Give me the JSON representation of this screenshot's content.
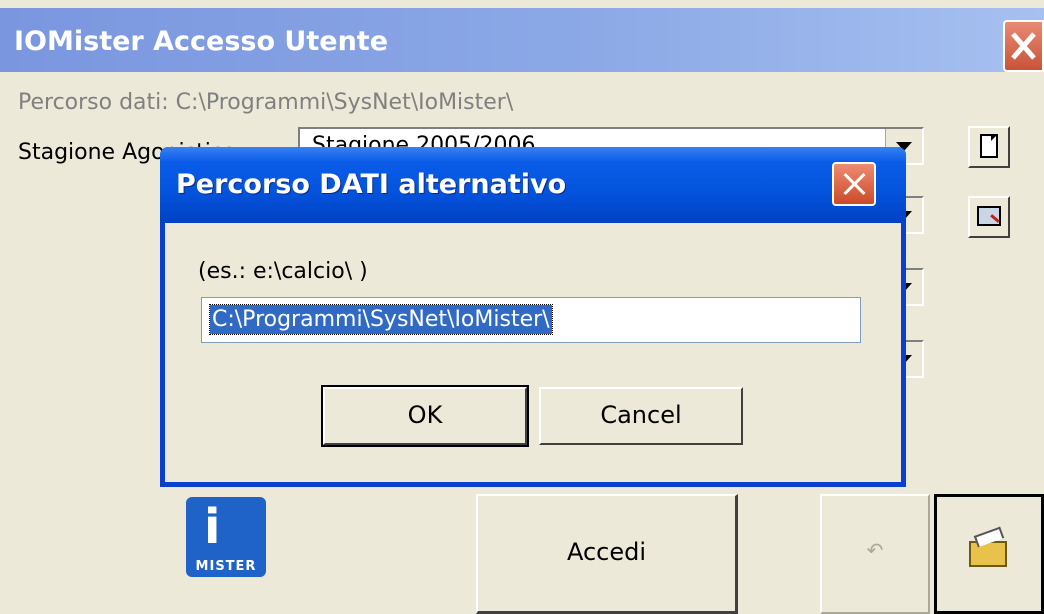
{
  "main": {
    "title": "IOMister Accesso Utente",
    "path_text": "Percorso dati: C:\\Programmi\\SysNet\\IoMister\\",
    "stagione_label": "Stagione Agonistica",
    "stagione_value": "Stagione 2005/2006",
    "logo_text": "MISTER",
    "accedi_label": "Accedi",
    "undo_label": "↶"
  },
  "dialog": {
    "title": "Percorso DATI alternativo",
    "hint": "(es.: e:\\calcio\\ )",
    "input_value": "C:\\Programmi\\SysNet\\IoMister\\",
    "ok_label": "OK",
    "cancel_label": "Cancel"
  },
  "icons": {
    "main_close": "close-icon",
    "dialog_close": "close-icon",
    "new": "new-document-icon",
    "preview": "print-preview-icon",
    "logo": "mister-logo-icon",
    "undo": "undo-icon",
    "open": "open-folder-icon"
  },
  "colors": {
    "dialog_title_blue": "#0453dc",
    "main_title_blue": "#8ba8e6",
    "selection_blue": "#316ac5",
    "window_bg": "#ece9d8"
  }
}
